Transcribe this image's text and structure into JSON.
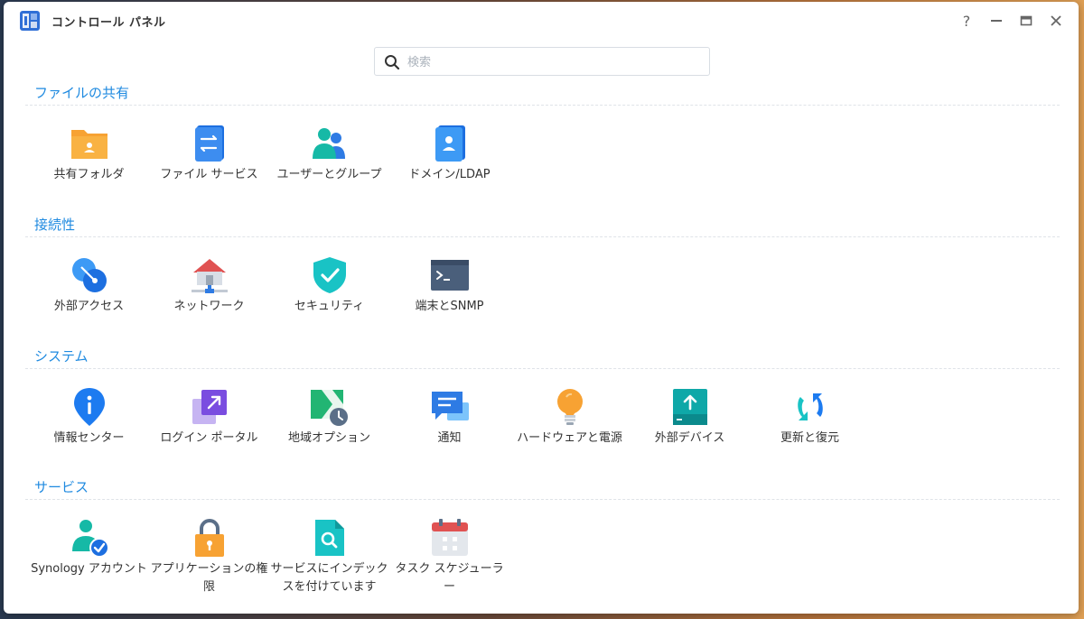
{
  "window": {
    "title": "コントロール パネル",
    "controls": {
      "help": "?",
      "minimize": "—",
      "maximize": "▭",
      "close": "✕"
    }
  },
  "search": {
    "placeholder": "検索",
    "value": ""
  },
  "sections": [
    {
      "title": "ファイルの共有",
      "items": [
        {
          "label": "共有フォルダ",
          "icon": "shared-folder-icon"
        },
        {
          "label": "ファイル サービス",
          "icon": "file-services-icon"
        },
        {
          "label": "ユーザーとグループ",
          "icon": "users-groups-icon"
        },
        {
          "label": "ドメイン/LDAP",
          "icon": "domain-ldap-icon"
        }
      ]
    },
    {
      "title": "接続性",
      "items": [
        {
          "label": "外部アクセス",
          "icon": "external-access-icon"
        },
        {
          "label": "ネットワーク",
          "icon": "network-icon"
        },
        {
          "label": "セキュリティ",
          "icon": "security-shield-icon"
        },
        {
          "label": "端末とSNMP",
          "icon": "terminal-snmp-icon"
        }
      ]
    },
    {
      "title": "システム",
      "items": [
        {
          "label": "情報センター",
          "icon": "info-center-icon"
        },
        {
          "label": "ログイン ポータル",
          "icon": "login-portal-icon"
        },
        {
          "label": "地域オプション",
          "icon": "regional-options-icon"
        },
        {
          "label": "通知",
          "icon": "notification-icon"
        },
        {
          "label": "ハードウェアと電源",
          "icon": "hardware-power-icon"
        },
        {
          "label": "外部デバイス",
          "icon": "external-devices-icon"
        },
        {
          "label": "更新と復元",
          "icon": "update-restore-icon"
        }
      ]
    },
    {
      "title": "サービス",
      "items": [
        {
          "label": "Synology アカウント",
          "icon": "synology-account-icon"
        },
        {
          "label": "アプリケーションの権限",
          "icon": "application-privileges-icon"
        },
        {
          "label": "サービスにインデックスを付けています",
          "icon": "indexing-service-icon"
        },
        {
          "label": "タスク スケジューラー",
          "icon": "task-scheduler-icon"
        }
      ]
    }
  ]
}
